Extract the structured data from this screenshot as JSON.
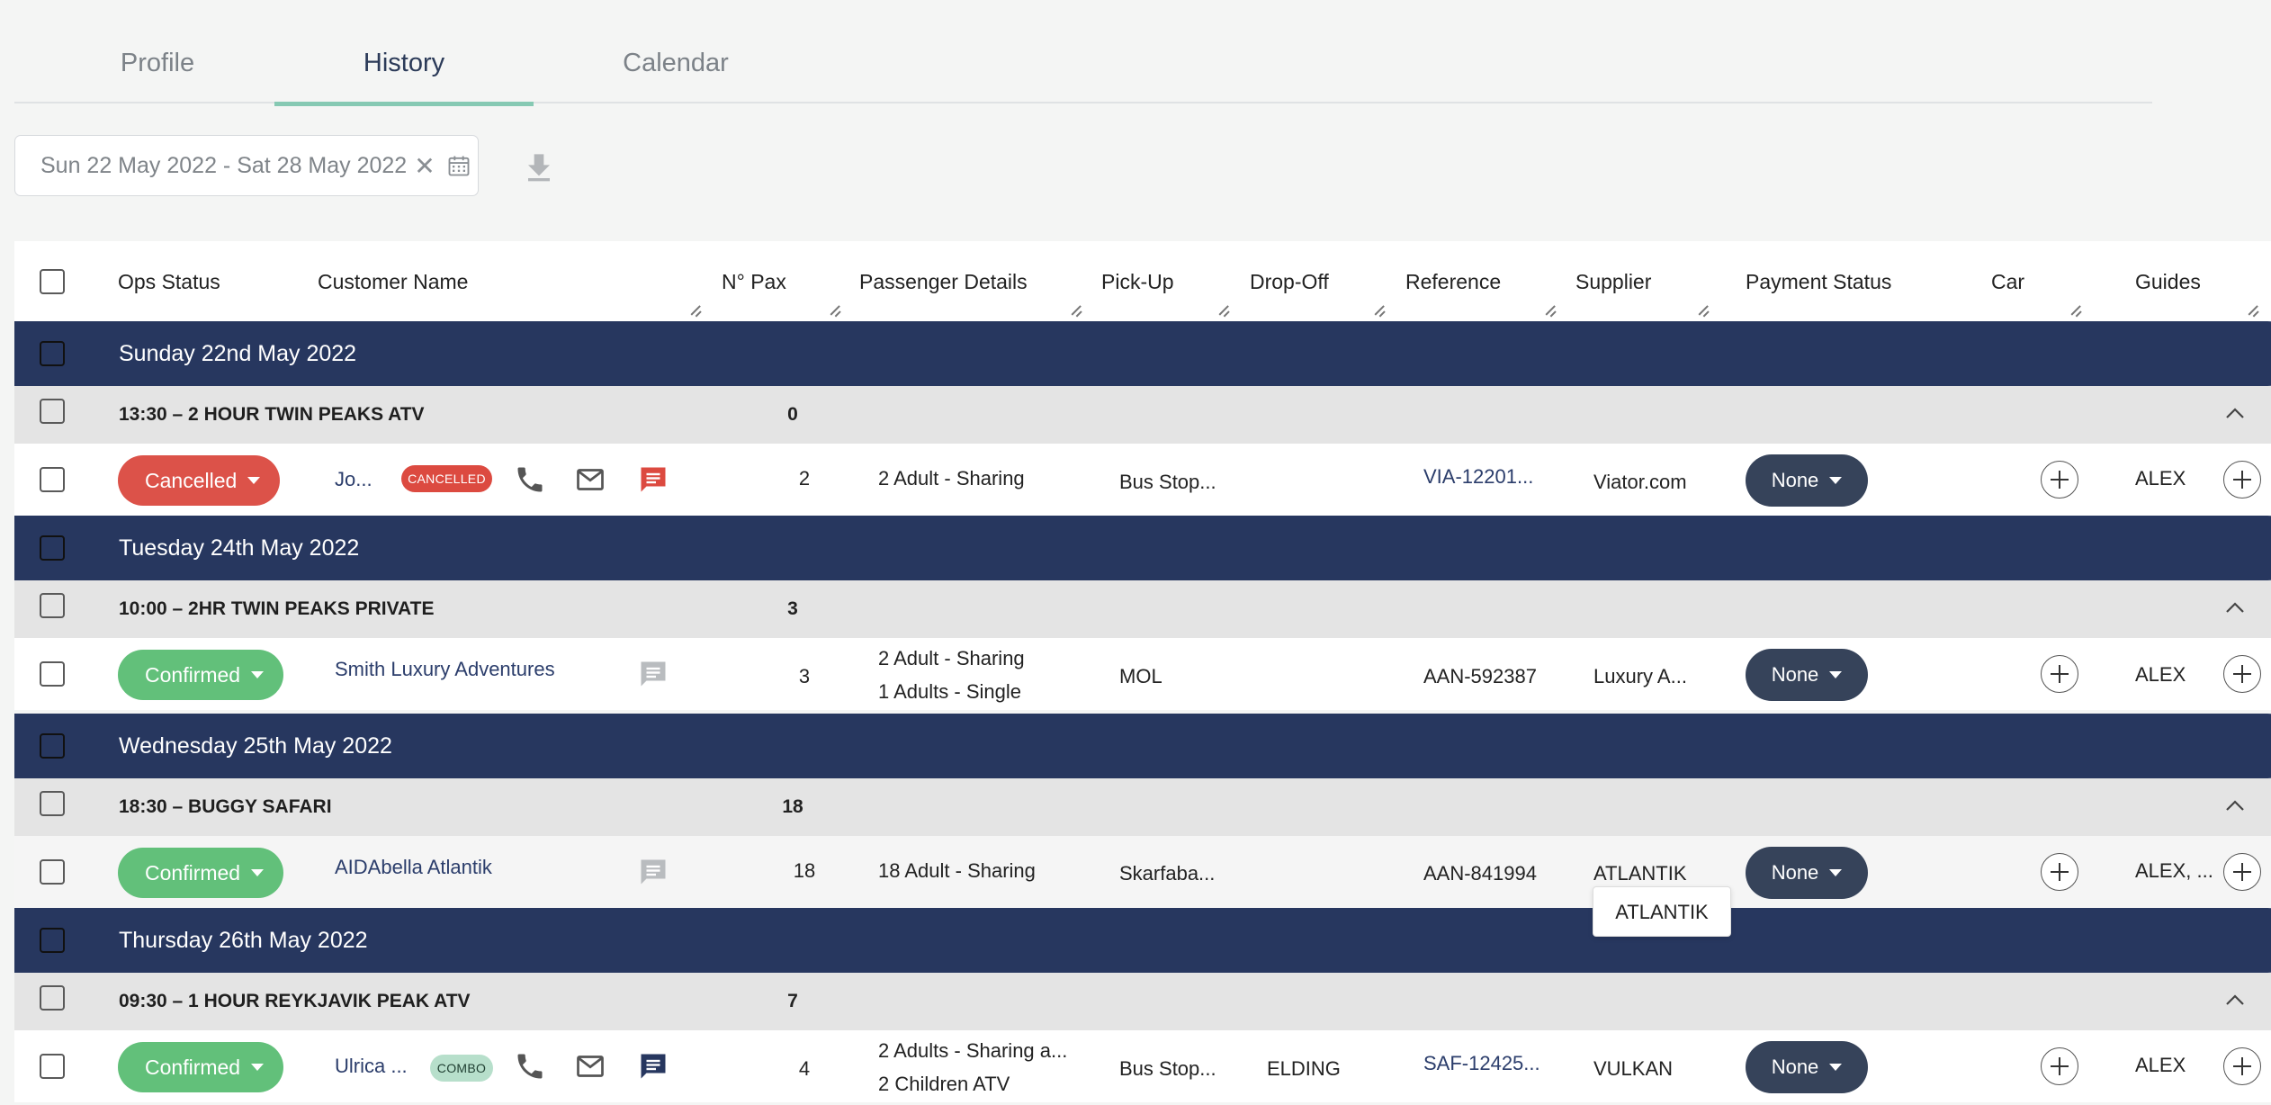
{
  "tabs": [
    {
      "label": "Profile",
      "active": false
    },
    {
      "label": "History",
      "active": true
    },
    {
      "label": "Calendar",
      "active": false
    }
  ],
  "toolbar": {
    "date_range": "Sun 22 May 2022 - Sat 28 May 2022",
    "clear_glyph": "✕"
  },
  "columns": {
    "ops_status": "Ops Status",
    "customer_name": "Customer Name",
    "pax": "N° Pax",
    "passenger_details": "Passenger Details",
    "pickup": "Pick-Up",
    "dropoff": "Drop-Off",
    "reference": "Reference",
    "supplier": "Supplier",
    "payment_status": "Payment Status",
    "car": "Car",
    "guides": "Guides"
  },
  "days": [
    {
      "label": "Sunday 22nd May 2022",
      "tour": {
        "label": "13:30 – 2 HOUR TWIN PEAKS ATV",
        "pax": "0"
      },
      "booking": {
        "status": "Cancelled",
        "customer": "Jo...",
        "badge": "CANCELLED",
        "pax": "2",
        "details": [
          "2 Adult - Sharing"
        ],
        "pickup": "Bus Stop...",
        "dropoff": "",
        "reference": "VIA-12201...",
        "supplier": "Viator.com",
        "payment": "None",
        "guides": "ALEX"
      }
    },
    {
      "label": "Tuesday 24th May 2022",
      "tour": {
        "label": "10:00 – 2HR TWIN PEAKS PRIVATE",
        "pax": "3"
      },
      "booking": {
        "status": "Confirmed",
        "customer": "Smith Luxury Adventures",
        "badge": "",
        "pax": "3",
        "details": [
          "2 Adult - Sharing",
          "1 Adults - Single"
        ],
        "pickup": "MOL",
        "dropoff": "",
        "reference": "AAN-592387",
        "supplier": "Luxury A...",
        "payment": "None",
        "guides": "ALEX"
      }
    },
    {
      "label": "Wednesday 25th May 2022",
      "tour": {
        "label": "18:30 – BUGGY SAFARI",
        "pax": "18"
      },
      "booking": {
        "status": "Confirmed",
        "customer": "AIDAbella Atlantik",
        "badge": "",
        "pax": "18",
        "details": [
          "18 Adult - Sharing"
        ],
        "pickup": "Skarfaba...",
        "dropoff": "",
        "reference": "AAN-841994",
        "supplier": "ATLANTIK",
        "payment": "None",
        "guides": "ALEX, ..."
      }
    },
    {
      "label": "Thursday 26th May 2022",
      "tour": {
        "label": "09:30 – 1 HOUR REYKJAVIK PEAK ATV",
        "pax": "7"
      },
      "booking": {
        "status": "Confirmed",
        "customer": "Ulrica ...",
        "badge": "COMBO",
        "pax": "4",
        "details": [
          "2 Adults - Sharing a...",
          "2 Children ATV"
        ],
        "pickup": "Bus Stop...",
        "dropoff": "ELDING",
        "reference": "SAF-12425...",
        "supplier": "VULKAN",
        "payment": "None",
        "guides": "ALEX"
      }
    }
  ],
  "tooltip": "ATLANTIK",
  "colors": {
    "navy": "#27375f",
    "cancelled": "#dc5249",
    "confirmed": "#62c07a",
    "payment": "#36435a",
    "tab_indicator": "#86c9b3"
  },
  "icons": [
    "phone-icon",
    "mail-icon",
    "message-icon",
    "calendar-icon",
    "download-icon",
    "chevron-up-icon",
    "plus-icon"
  ]
}
